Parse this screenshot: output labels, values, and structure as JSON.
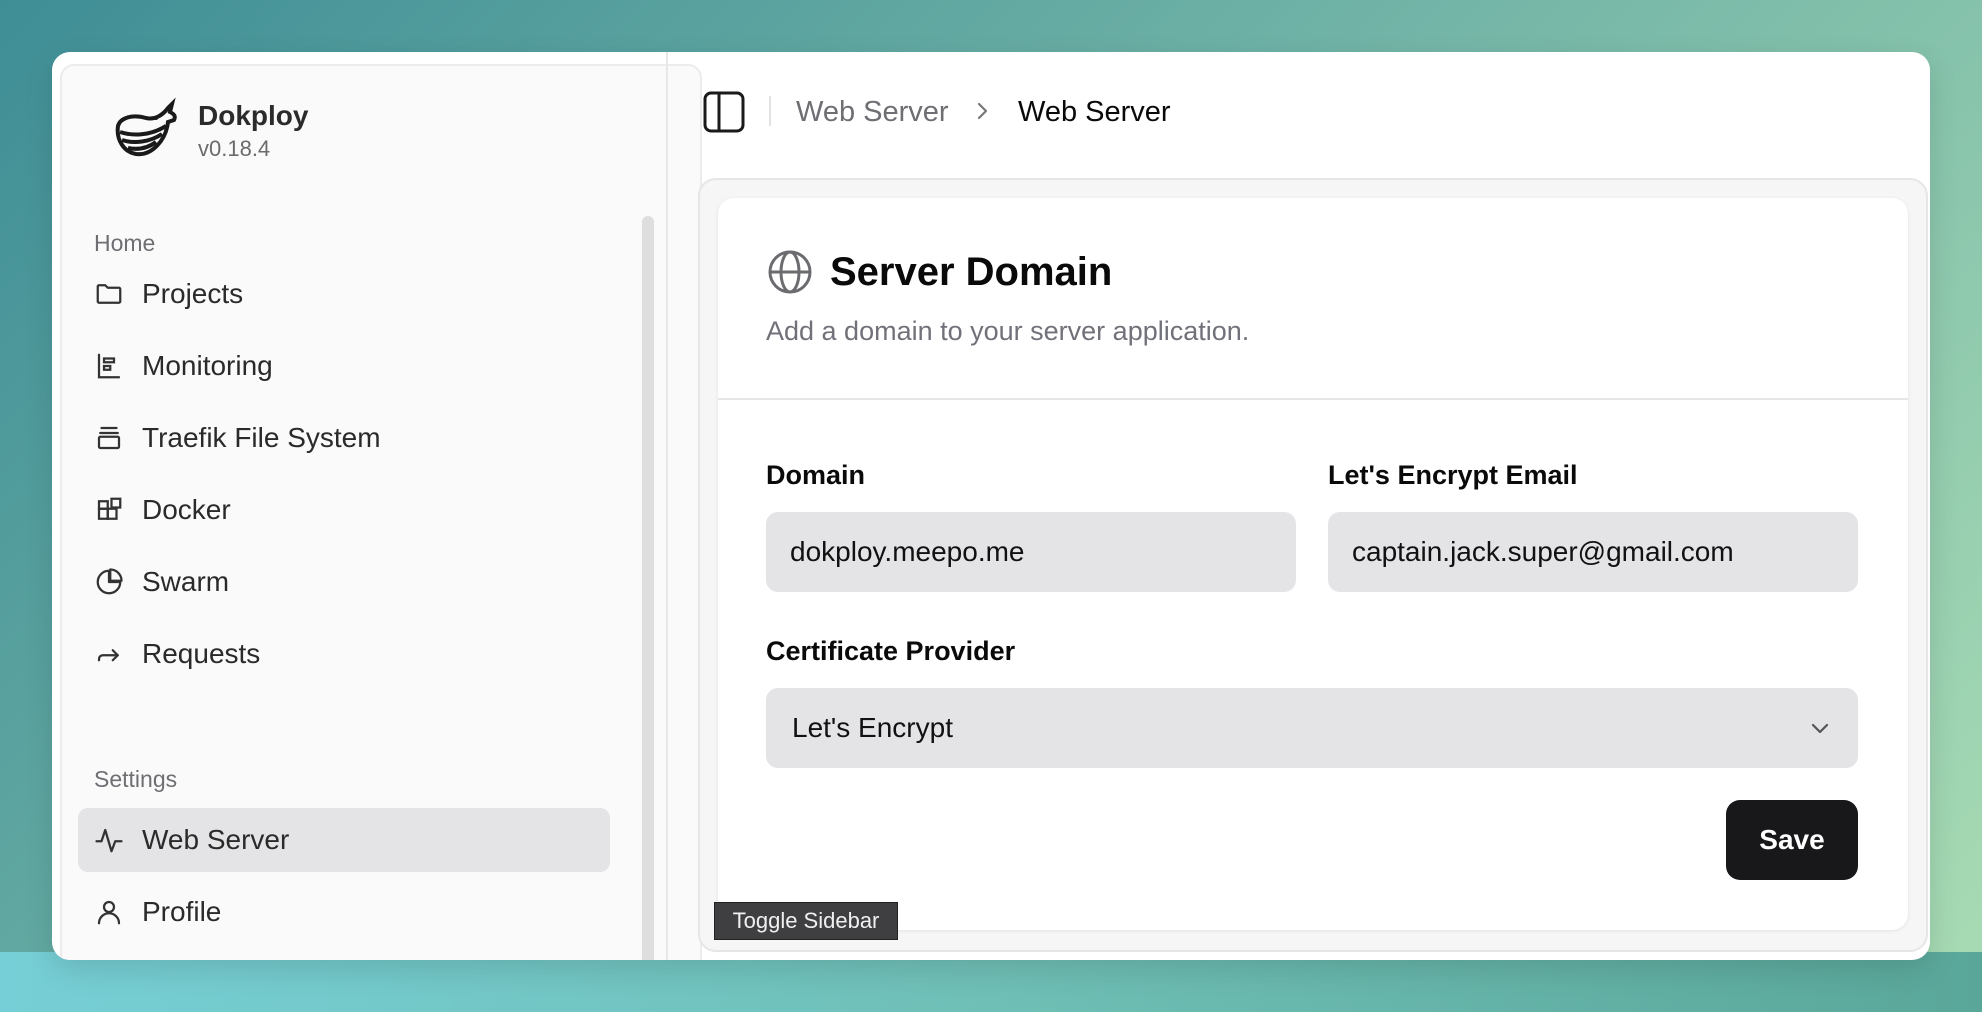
{
  "brand": {
    "name": "Dokploy",
    "version": "v0.18.4"
  },
  "sidebar": {
    "sections": [
      {
        "label": "Home"
      },
      {
        "label": "Settings"
      }
    ],
    "home_items": [
      {
        "label": "Projects",
        "icon": "folder-icon"
      },
      {
        "label": "Monitoring",
        "icon": "bar-chart-icon"
      },
      {
        "label": "Traefik File System",
        "icon": "layers-icon"
      },
      {
        "label": "Docker",
        "icon": "blocks-icon"
      },
      {
        "label": "Swarm",
        "icon": "pie-chart-icon"
      },
      {
        "label": "Requests",
        "icon": "forward-arrow-icon"
      }
    ],
    "settings_items": [
      {
        "label": "Web Server",
        "icon": "activity-icon",
        "active": true
      },
      {
        "label": "Profile",
        "icon": "user-icon"
      }
    ]
  },
  "header": {
    "breadcrumb": [
      "Web Server",
      "Web Server"
    ]
  },
  "card": {
    "title": "Server Domain",
    "description": "Add a domain to your server application.",
    "domain_label": "Domain",
    "domain_value": "dokploy.meepo.me",
    "email_label": "Let's Encrypt Email",
    "email_value": "captain.jack.super@gmail.com",
    "provider_label": "Certificate Provider",
    "provider_value": "Let's Encrypt",
    "save_label": "Save"
  },
  "tooltip": {
    "text": "Toggle Sidebar"
  },
  "colors": {
    "primary_button": "#18181b",
    "active_nav": "#e4e4e6",
    "input_bg": "#e4e4e7"
  }
}
